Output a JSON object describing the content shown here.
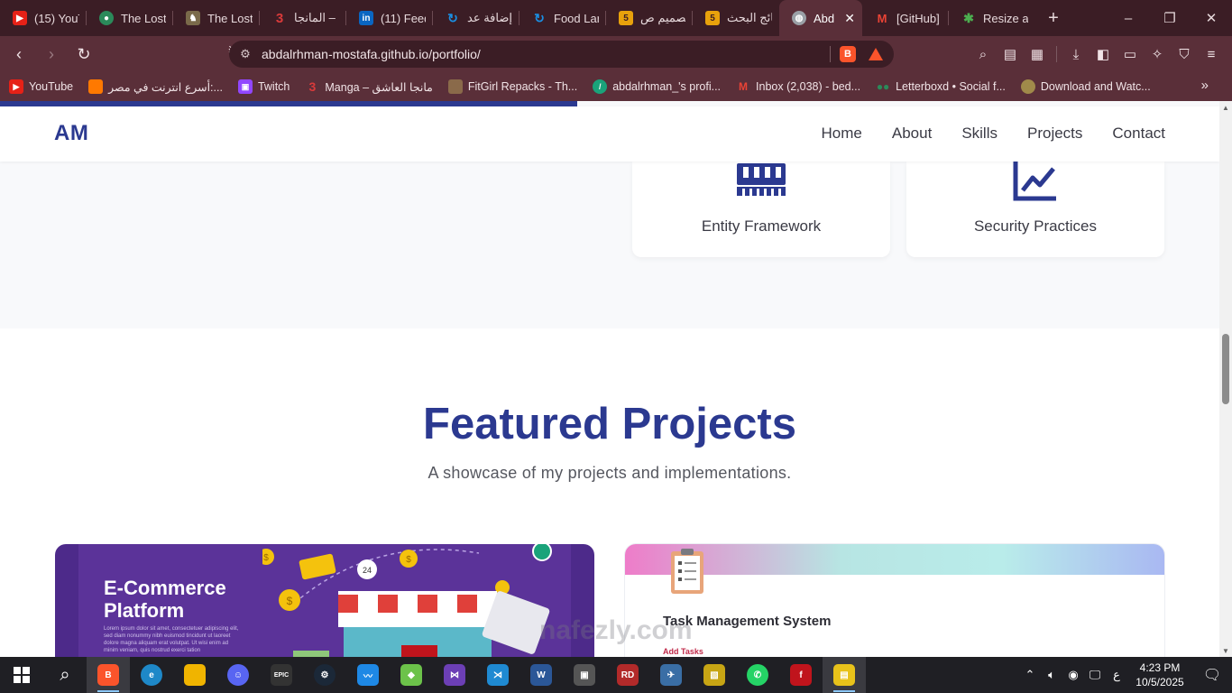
{
  "browser": {
    "tabs": [
      {
        "label": "(15) YouT",
        "icon": "youtube-icon",
        "color": "#e62117"
      },
      {
        "label": "The Lost",
        "icon": "letterboxd-icon",
        "color": "#2b8a5a"
      },
      {
        "label": "The Lost",
        "icon": "owl-icon",
        "color": "#7a6a4a"
      },
      {
        "label": "المانجا –",
        "icon": "manga-3-icon",
        "color": "#d93a3a"
      },
      {
        "label": "(11) Feed",
        "icon": "linkedin-icon",
        "color": "#0a66c2"
      },
      {
        "label": "إضافة عد",
        "icon": "refresh-blue-icon",
        "color": "#1a8fe3"
      },
      {
        "label": "Food Lar",
        "icon": "refresh-blue-icon",
        "color": "#1a8fe3"
      },
      {
        "label": "تصميم ص",
        "icon": "five-icon",
        "color": "#e8a10c"
      },
      {
        "label": "نتائج البحث",
        "icon": "five-icon",
        "color": "#e8a10c"
      },
      {
        "label": "Abd",
        "icon": "globe-icon",
        "color": "#9aa0a6",
        "active": true
      },
      {
        "label": "[GitHub]",
        "icon": "gmail-icon",
        "color": "#ea4335"
      },
      {
        "label": "Resize ar",
        "icon": "pinwheel-icon",
        "color": "#4caf50"
      }
    ],
    "new_tab": "+",
    "window_controls": {
      "minimize": "–",
      "maximize": "❐",
      "close": "✕"
    },
    "url": "abdalrhman-mostafa.github.io/portfolio/",
    "bookmarks": [
      {
        "label": "YouTube",
        "icon": "youtube-icon",
        "color": "#e62117"
      },
      {
        "label": "أسرع انترنت في مصر:...",
        "icon": "orange-icon",
        "color": "#ff7900"
      },
      {
        "label": "Twitch",
        "icon": "twitch-icon",
        "color": "#9146ff"
      },
      {
        "label": "Manga – مانجا العاشق",
        "icon": "manga-3-icon",
        "color": "#d93a3a"
      },
      {
        "label": "FitGirl Repacks - Th...",
        "icon": "fitgirl-icon",
        "color": "#8a6a4a"
      },
      {
        "label": "abdalrhman_'s profi...",
        "icon": "slash-icon",
        "color": "#1aa37a"
      },
      {
        "label": "Inbox (2,038) - bed...",
        "icon": "gmail-icon",
        "color": "#ea4335"
      },
      {
        "label": "Letterboxd • Social f...",
        "icon": "letterboxd-icon",
        "color": "#2b8a5a"
      },
      {
        "label": "Download and Watc...",
        "icon": "download-site-icon",
        "color": "#a08a4a"
      }
    ],
    "bookmarks_more": "»"
  },
  "site": {
    "logo": "AM",
    "nav": [
      "Home",
      "About",
      "Skills",
      "Projects",
      "Contact"
    ],
    "skills": [
      {
        "title": "Entity Framework",
        "icon": "memory-chip-icon"
      },
      {
        "title": "Security Practices",
        "icon": "line-chart-icon"
      }
    ],
    "projects_heading": "Featured Projects",
    "projects_subheading": "A showcase of my projects and implementations.",
    "projects": [
      {
        "title": "E-Commerce Platform",
        "image_text": "Lorem ipsum dolor sit amet, consectetuer adipiscing elit, sed diam nonummy nibh euismod tincidunt ut laoreet dolore magna aliquam erat volutpat. Ut wisi enim ad minim veniam, quis nostrud exerci tation"
      },
      {
        "title": "Task Management System",
        "image_text": "Add Tasks"
      }
    ]
  },
  "watermark": "nafezly.com",
  "taskbar": {
    "apps": [
      {
        "name": "brave",
        "color": "#fb542b",
        "running": true
      },
      {
        "name": "edge",
        "color": "#1e88c8"
      },
      {
        "name": "file-explorer",
        "color": "#f0b400"
      },
      {
        "name": "discord",
        "color": "#5865f2"
      },
      {
        "name": "epic-games",
        "color": "#333333",
        "glyph": "EPIC"
      },
      {
        "name": "steam",
        "color": "#1b2838"
      },
      {
        "name": "app-blue",
        "color": "#1e88e5"
      },
      {
        "name": "bluestacks",
        "color": "#6cc24a"
      },
      {
        "name": "visual-studio",
        "color": "#6c3fb5"
      },
      {
        "name": "vs-code",
        "color": "#1f8ad2"
      },
      {
        "name": "word",
        "color": "#2b5797"
      },
      {
        "name": "photo-app",
        "color": "#555555"
      },
      {
        "name": "rd-app",
        "color": "#b22a2a",
        "glyph": "RD"
      },
      {
        "name": "wing-app",
        "color": "#3a6ea5"
      },
      {
        "name": "pic-app",
        "color": "#c7a514"
      },
      {
        "name": "whatsapp",
        "color": "#25d366"
      },
      {
        "name": "red-app",
        "color": "#c0141c"
      },
      {
        "name": "yellow-app",
        "color": "#e8c21a",
        "running": true
      }
    ],
    "keyboard_lang": "ع",
    "time": "4:23 PM",
    "date": "10/5/2025"
  },
  "colors": {
    "brand": "#2b3990",
    "tab_bg": "#3b1d25",
    "toolbar_bg": "#5a2f39"
  }
}
